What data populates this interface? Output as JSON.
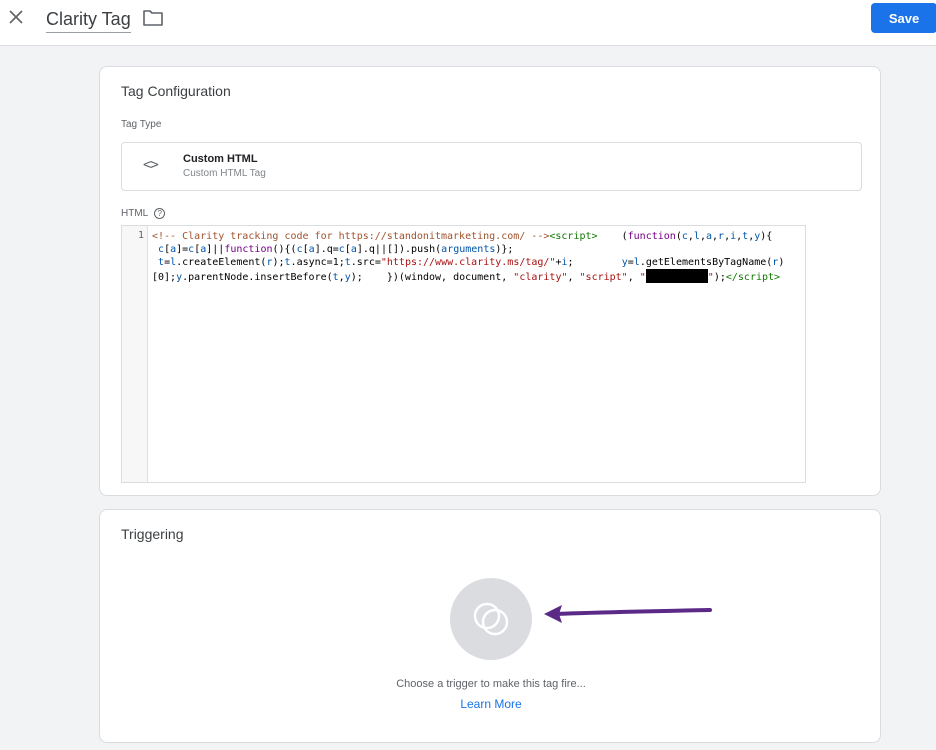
{
  "header": {
    "tag_name": "Clarity Tag",
    "save_label": "Save"
  },
  "config": {
    "title": "Tag Configuration",
    "tag_type_label": "Tag Type",
    "tag_type": {
      "name": "Custom HTML",
      "subtitle": "Custom HTML Tag"
    },
    "html_label": "HTML",
    "editor": {
      "line_number": "1"
    }
  },
  "triggering": {
    "title": "Triggering",
    "hint": "Choose a trigger to make this tag fire...",
    "learn_more": "Learn More"
  },
  "icons": {
    "close": "close-icon",
    "folder": "folder-icon",
    "code": "code-icon",
    "help": "help-icon",
    "trigger": "trigger-icon"
  },
  "colors": {
    "accent": "#1a73e8",
    "annotation_arrow": "#5b2a86"
  }
}
